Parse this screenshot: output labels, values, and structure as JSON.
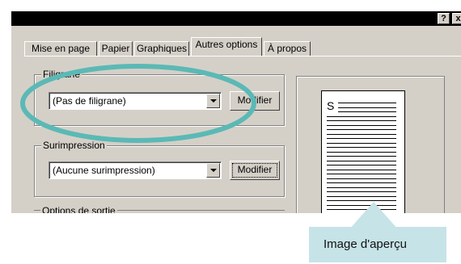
{
  "window": {
    "help_button": "?",
    "close_button": "x"
  },
  "tabs": [
    {
      "label": "Mise en page"
    },
    {
      "label": "Papier"
    },
    {
      "label": "Graphiques"
    },
    {
      "label": "Autres options",
      "active": true
    },
    {
      "label": "À propos"
    }
  ],
  "watermark": {
    "group_label": "Filigrane",
    "value": "(Pas de filigrane)",
    "button": "Modifier"
  },
  "overlay": {
    "group_label": "Surimpression",
    "value": "(Aucune surimpression)",
    "button": "Modifier"
  },
  "output_options": {
    "group_label": "Options de sortie"
  },
  "preview": {
    "letter": "S"
  },
  "callout": {
    "text": "Image d'aperçu",
    "background": "#c6e3e7"
  },
  "highlight": {
    "color": "#5bb9b5"
  }
}
